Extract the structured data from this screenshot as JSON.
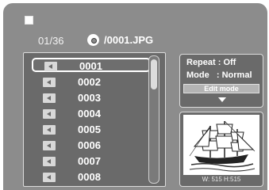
{
  "header": {
    "page_counter": "01/36",
    "file_path": "/0001.JPG"
  },
  "file_list": {
    "selected_index": 0,
    "items": [
      {
        "label": "0001"
      },
      {
        "label": "0002"
      },
      {
        "label": "0003"
      },
      {
        "label": "0004"
      },
      {
        "label": "0005"
      },
      {
        "label": "0006"
      },
      {
        "label": "0007"
      },
      {
        "label": "0008"
      }
    ],
    "scroll_position": 0.0
  },
  "info_panel": {
    "repeat": "Repeat : Off",
    "mode": "Mode   : Normal",
    "edit_mode_label": "Edit mode"
  },
  "preview": {
    "dimensions": "W: 515  H:515"
  },
  "colors": {
    "background": "#8c8c8c",
    "panel": "#6a6a6a",
    "text": "#ffffff"
  }
}
